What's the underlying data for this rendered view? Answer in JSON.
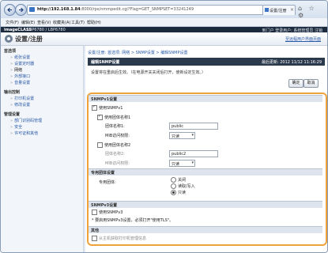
{
  "browser": {
    "url_host": "http://192.168.1.84",
    "url_rest": ":8000/rps/nmmpedit.cgi?Flag=GET_SNMPSET=33241249",
    "addr_tools": "⌕ ▾ ↻ ×",
    "tab_label": "设置/注册",
    "window_tools": "⌂ ☆ ⚙",
    "menu": [
      "文件(F)",
      "编辑(E)",
      "查看(V)",
      "收藏夹(A)",
      "工具(T)",
      "帮助(H)"
    ]
  },
  "app": {
    "brand": "imageCLASS",
    "device": "LBP6780 / LBP6780",
    "header_right": "到门户  登录用户: 系统管理员  注销",
    "page_title": "设置/注册",
    "jump_link": "至远程用户界面页面"
  },
  "sidebar": {
    "sections": [
      {
        "title": "首选项",
        "items": [
          "纸张设置",
          "设置定时器",
          "网络",
          "外部接口",
          "音量设置"
        ]
      },
      {
        "title": "输出控制",
        "items": [
          "打印机设置",
          "修改设置"
        ]
      },
      {
        "title": "管理设置",
        "items": [
          "部门识别码管理",
          "安全",
          "许可证和其他"
        ]
      }
    ]
  },
  "main": {
    "breadcrumb": "设置/注册: 首选项: 网络 > SNMP设置 > 编辑SNMP设置",
    "panel_title": "编辑SNMP设置",
    "last_updated": "最后更新: 2012 11/12 11:16:29",
    "info": "设置将在重启后生效。（在电源开关关闭后打开，使新设定生效。）",
    "ok": "确定",
    "cancel": "取消",
    "v1": {
      "heading": "SNMPv1设置",
      "use_v1": "使用SNMPv1",
      "use_community1": "使用团体名称1",
      "community1_label": "团体名称1:",
      "community1_value": "public",
      "mib1_label": "MIB访问权限:",
      "mib1_value": "只读",
      "use_community2": "使用团体名称2",
      "community2_label": "团体名称2:",
      "community2_value": "public2",
      "mib2_label": "MIB访问权限:",
      "mib2_value": "只读"
    },
    "dedicated": {
      "heading": "专用团体设置",
      "label": "专用团体:",
      "options": [
        "关闭",
        "读取/写入",
        "只读"
      ]
    },
    "v3": {
      "heading": "SNMPv3设置",
      "use_v3": "使用SNMPv3",
      "note": "* 要启用SNMPv3设置，必须打开\"使用TLS\"。"
    },
    "other": {
      "heading": "其他",
      "item": "从主机获取打印机管理信息"
    }
  }
}
